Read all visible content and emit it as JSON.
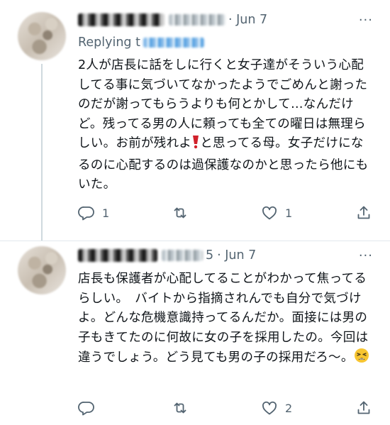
{
  "tweets": [
    {
      "date": "· Jun 7",
      "more": "···",
      "replying_prefix": "Replying t",
      "text": "2人が店長に話をしに行くと女子達がそういう心配してる事に気づいてなかったようでごめんと謝ったのだが謝ってもらうよりも何とかして…なんだけど。残ってる男の人に頼っても全ての曜日は無理らしい。お前が残れよ",
      "text_after_emoji": "と思ってる母。女子だけになるのに心配するのは過保護なのかと思ったら他にもいた。",
      "reply_count": "1",
      "retweet_count": "",
      "like_count": "1"
    },
    {
      "handle_suffix": "5",
      "date": "· Jun 7",
      "more": "···",
      "text": "店長も保護者が心配してることがわかって焦ってるらしい。　バイトから指摘されんでも自分で気づけよ。どんな危機意識持ってるんだか。面接には男の子もきてたのに何故に女の子を採用したの。今回は違うでしょう。どう見ても男の子の採用だろ〜。",
      "reply_count": "",
      "retweet_count": "",
      "like_count": "2"
    }
  ],
  "icons": [
    "reply-icon",
    "retweet-icon",
    "like-icon",
    "share-icon",
    "exclamation-emoji-icon",
    "weary-emoji-icon"
  ],
  "colors": {
    "text": "#0f1419",
    "secondary": "#536471",
    "divider": "#e1e8ed",
    "emoji_red": "#d1212b",
    "emoji_yellow": "#f7c531"
  }
}
